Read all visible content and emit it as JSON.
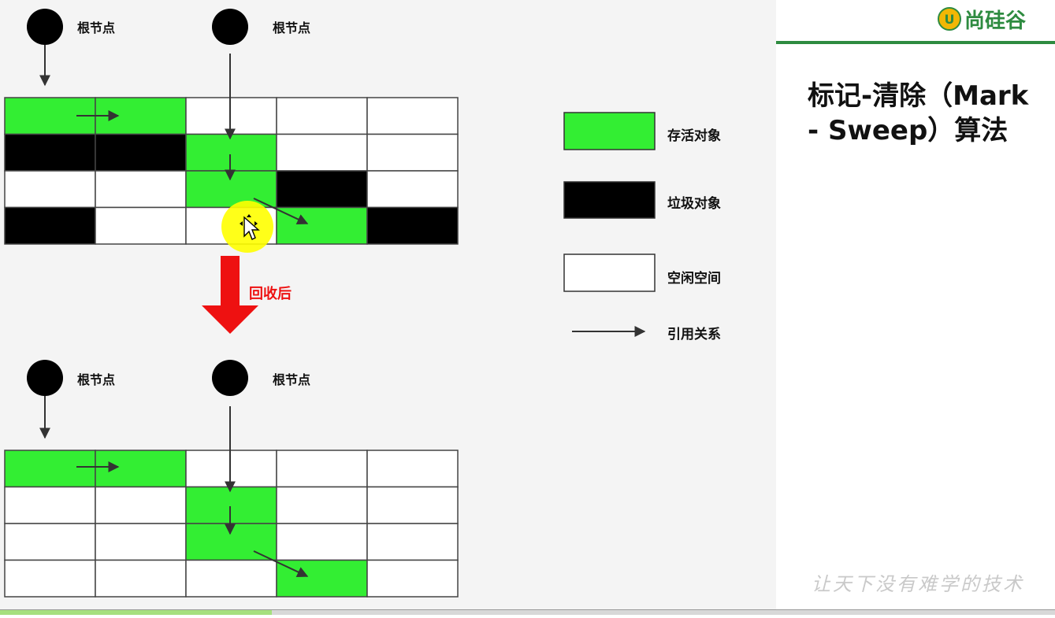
{
  "labels": {
    "root_node": "根节点",
    "after_gc": "回收后"
  },
  "legend": {
    "live": "存活对象",
    "garbage": "垃圾对象",
    "free": "空闲空间",
    "reference": "引用关系"
  },
  "slide": {
    "brand": "尚硅谷",
    "title_line1": "标记-清除（Mark",
    "title_line2": "- Sweep）算法",
    "slogan": "让天下没有难学的技术"
  },
  "grids": {
    "before": [
      [
        "live",
        "live",
        "free",
        "free",
        "free"
      ],
      [
        "garbage",
        "garbage",
        "live",
        "free",
        "free"
      ],
      [
        "free",
        "free",
        "live",
        "garbage",
        "free"
      ],
      [
        "garbage",
        "free",
        "free",
        "live",
        "garbage"
      ]
    ],
    "after": [
      [
        "live",
        "live",
        "free",
        "free",
        "free"
      ],
      [
        "free",
        "free",
        "live",
        "free",
        "free"
      ],
      [
        "free",
        "free",
        "live",
        "free",
        "free"
      ],
      [
        "free",
        "free",
        "free",
        "live",
        "free"
      ]
    ]
  },
  "colors": {
    "live": "#33ee33",
    "garbage": "#000000",
    "free": "#ffffff",
    "after_arrow": "#ee1111",
    "brand": "#2e8b40",
    "cursor_highlight": "#ffff00"
  }
}
